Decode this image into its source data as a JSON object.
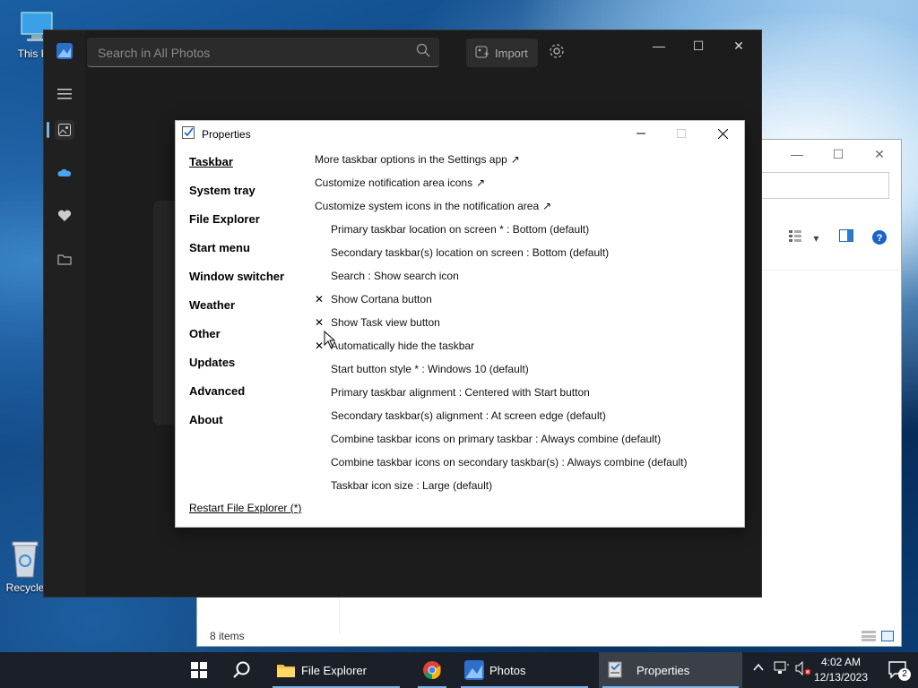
{
  "desktop": {
    "icons": [
      {
        "label": "This PC"
      },
      {
        "label": "Recycle"
      }
    ]
  },
  "explorer": {
    "status_items": "8 items"
  },
  "photos": {
    "search_placeholder": "Search in All Photos",
    "import_label": "Import"
  },
  "properties": {
    "title": "Properties",
    "nav": [
      {
        "label": "Taskbar",
        "selected": true
      },
      {
        "label": "System tray"
      },
      {
        "label": "File Explorer"
      },
      {
        "label": "Start menu"
      },
      {
        "label": "Window switcher"
      },
      {
        "label": "Weather"
      },
      {
        "label": "Other"
      },
      {
        "label": "Updates"
      },
      {
        "label": "Advanced"
      },
      {
        "label": "About"
      }
    ],
    "options": [
      {
        "label": "More taskbar options in the Settings app",
        "external": "↗"
      },
      {
        "label": "Customize notification area icons",
        "external": "↗"
      },
      {
        "label": "Customize system icons in the notification area",
        "external": "↗"
      },
      {
        "label": "Primary taskbar location on screen * : Bottom (default)"
      },
      {
        "label": "Secondary taskbar(s) location on screen : Bottom (default)"
      },
      {
        "label": "Search : Show search icon"
      },
      {
        "label": "Show Cortana button",
        "check": "✕"
      },
      {
        "label": "Show Task view button",
        "check": "✕"
      },
      {
        "label": "Automatically hide the taskbar",
        "check": "✕"
      },
      {
        "label": "Start button style * : Windows 10 (default)"
      },
      {
        "label": "Primary taskbar alignment : Centered with Start button"
      },
      {
        "label": "Secondary taskbar(s) alignment : At screen edge (default)"
      },
      {
        "label": "Combine taskbar icons on primary taskbar : Always combine (default)"
      },
      {
        "label": "Combine taskbar icons on secondary taskbar(s) : Always combine (default)"
      },
      {
        "label": "Taskbar icon size : Large (default)"
      }
    ],
    "restart_label": "Restart File Explorer (*)"
  },
  "taskbar": {
    "apps": [
      {
        "label": "File Explorer"
      },
      {
        "label": "Photos"
      },
      {
        "label": "Properties",
        "active": true
      }
    ],
    "time": "4:02 AM",
    "date": "12/13/2023",
    "notification_count": "2"
  },
  "colors": {
    "taskbar_bg": "#1b1f27",
    "photos_bg": "#1c1c1c",
    "accent": "#7fb2e5"
  }
}
